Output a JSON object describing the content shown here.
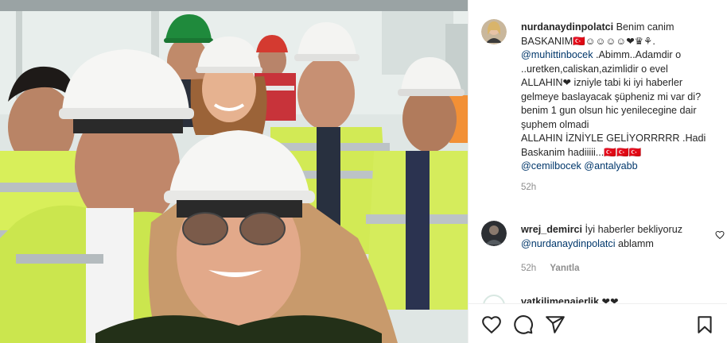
{
  "post": {
    "author": "nurdanaydinpolatci",
    "caption_lines": [
      {
        "text": "Benim canim"
      },
      {
        "text": "BASKANIM🇹🇷☺☺☺☺❤♛⚘."
      },
      {
        "mention": "@muhittinbocek",
        "text": " .Abimm..Adamdir o"
      },
      {
        "text": "..uretken,caliskan,azimlidir o evel"
      },
      {
        "text": "ALLAHIN❤ izniyle tabi ki iyi haberler"
      },
      {
        "text": "gelmeye baslayacak şüpheniz mi var di?"
      },
      {
        "text": "benim 1 gun olsun hic yenilecegine dair"
      },
      {
        "text": "şuphem olmadi"
      },
      {
        "text": "ALLAHIN İZNİYLE GELİYORRRRR .Hadi"
      },
      {
        "text": "Baskanim hadiiiii...🇹🇷🇹🇷🇹🇷"
      }
    ],
    "tag_1": "@cemilbocek",
    "tag_2": "@antalyabb",
    "time": "52h"
  },
  "comment": {
    "author": "wrej_demirci",
    "text": "İyi haberler bekliyoruz",
    "mention": "@nurdanaydinpolatci",
    "text_2": "ablamm",
    "time": "52h",
    "reply_label": "Yanıtla"
  },
  "next_comment": {
    "author": "vatkilimenajerlik",
    "text": "❤❤"
  },
  "actions": {
    "like_icon": "heart-icon",
    "comment_icon": "comment-bubble-icon",
    "share_icon": "paper-plane-icon",
    "save_icon": "bookmark-icon"
  },
  "colors": {
    "mention": "#00376b",
    "meta": "#8e8e8e",
    "text": "#262626",
    "vest": "#c8e84a",
    "helmet": "#f4f4f2"
  }
}
